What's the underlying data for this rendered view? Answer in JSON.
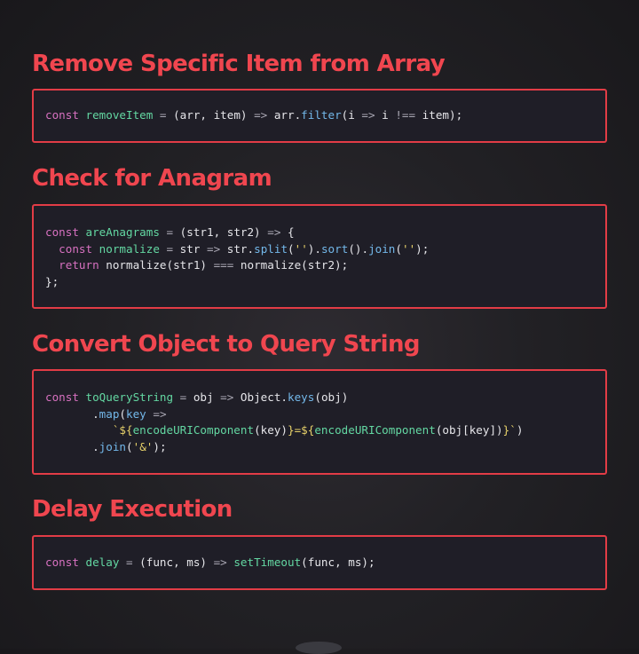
{
  "snippets": [
    {
      "title": "Remove Specific Item from Array",
      "lines": [
        [
          {
            "t": "const ",
            "c": "k"
          },
          {
            "t": "removeItem",
            "c": "f"
          },
          {
            "t": " = ",
            "c": "o"
          },
          {
            "t": "(arr, item) ",
            "c": "p"
          },
          {
            "t": "=>",
            "c": "o"
          },
          {
            "t": " arr.",
            "c": "p"
          },
          {
            "t": "filter",
            "c": "m"
          },
          {
            "t": "(i ",
            "c": "p"
          },
          {
            "t": "=>",
            "c": "o"
          },
          {
            "t": " i ",
            "c": "p"
          },
          {
            "t": "!==",
            "c": "o"
          },
          {
            "t": " item);",
            "c": "p"
          }
        ]
      ]
    },
    {
      "title": "Check for Anagram",
      "lines": [
        [
          {
            "t": "const ",
            "c": "k"
          },
          {
            "t": "areAnagrams",
            "c": "f"
          },
          {
            "t": " = ",
            "c": "o"
          },
          {
            "t": "(str1, str2) ",
            "c": "p"
          },
          {
            "t": "=>",
            "c": "o"
          },
          {
            "t": " {",
            "c": "p"
          }
        ],
        [
          {
            "t": "  const ",
            "c": "k"
          },
          {
            "t": "normalize",
            "c": "f"
          },
          {
            "t": " = ",
            "c": "o"
          },
          {
            "t": "str ",
            "c": "p"
          },
          {
            "t": "=>",
            "c": "o"
          },
          {
            "t": " str.",
            "c": "p"
          },
          {
            "t": "split",
            "c": "m"
          },
          {
            "t": "(",
            "c": "p"
          },
          {
            "t": "''",
            "c": "s"
          },
          {
            "t": ").",
            "c": "p"
          },
          {
            "t": "sort",
            "c": "m"
          },
          {
            "t": "().",
            "c": "p"
          },
          {
            "t": "join",
            "c": "m"
          },
          {
            "t": "(",
            "c": "p"
          },
          {
            "t": "''",
            "c": "s"
          },
          {
            "t": ");",
            "c": "p"
          }
        ],
        [
          {
            "t": "  return ",
            "c": "k"
          },
          {
            "t": "normalize(str1) ",
            "c": "p"
          },
          {
            "t": "===",
            "c": "o"
          },
          {
            "t": " normalize(str2);",
            "c": "p"
          }
        ],
        [
          {
            "t": "};",
            "c": "p"
          }
        ]
      ]
    },
    {
      "title": "Convert Object to Query String",
      "lines": [
        [
          {
            "t": "const ",
            "c": "k"
          },
          {
            "t": "toQueryString",
            "c": "f"
          },
          {
            "t": " = ",
            "c": "o"
          },
          {
            "t": "obj ",
            "c": "p"
          },
          {
            "t": "=>",
            "c": "o"
          },
          {
            "t": " Object.",
            "c": "p"
          },
          {
            "t": "keys",
            "c": "m"
          },
          {
            "t": "(obj)",
            "c": "p"
          }
        ],
        [
          {
            "t": "       .",
            "c": "p"
          },
          {
            "t": "map",
            "c": "m"
          },
          {
            "t": "(",
            "c": "p"
          },
          {
            "t": "key ",
            "c": "m"
          },
          {
            "t": "=>",
            "c": "o"
          }
        ],
        [
          {
            "t": "          `",
            "c": "s"
          },
          {
            "t": "${",
            "c": "s"
          },
          {
            "t": "encodeURIComponent",
            "c": "f"
          },
          {
            "t": "(key)",
            "c": "p"
          },
          {
            "t": "}=${",
            "c": "s"
          },
          {
            "t": "encodeURIComponent",
            "c": "f"
          },
          {
            "t": "(obj[key])",
            "c": "p"
          },
          {
            "t": "}`",
            "c": "s"
          },
          {
            "t": ")",
            "c": "p"
          }
        ],
        [
          {
            "t": "       .",
            "c": "p"
          },
          {
            "t": "join",
            "c": "m"
          },
          {
            "t": "(",
            "c": "p"
          },
          {
            "t": "'&'",
            "c": "s"
          },
          {
            "t": ");",
            "c": "p"
          }
        ]
      ]
    },
    {
      "title": "Delay Execution",
      "lines": [
        [
          {
            "t": "const ",
            "c": "k"
          },
          {
            "t": "delay",
            "c": "f"
          },
          {
            "t": " = ",
            "c": "o"
          },
          {
            "t": "(func, ms) ",
            "c": "p"
          },
          {
            "t": "=>",
            "c": "o"
          },
          {
            "t": " ",
            "c": "p"
          },
          {
            "t": "setTimeout",
            "c": "f"
          },
          {
            "t": "(func, ms);",
            "c": "p"
          }
        ]
      ]
    }
  ]
}
